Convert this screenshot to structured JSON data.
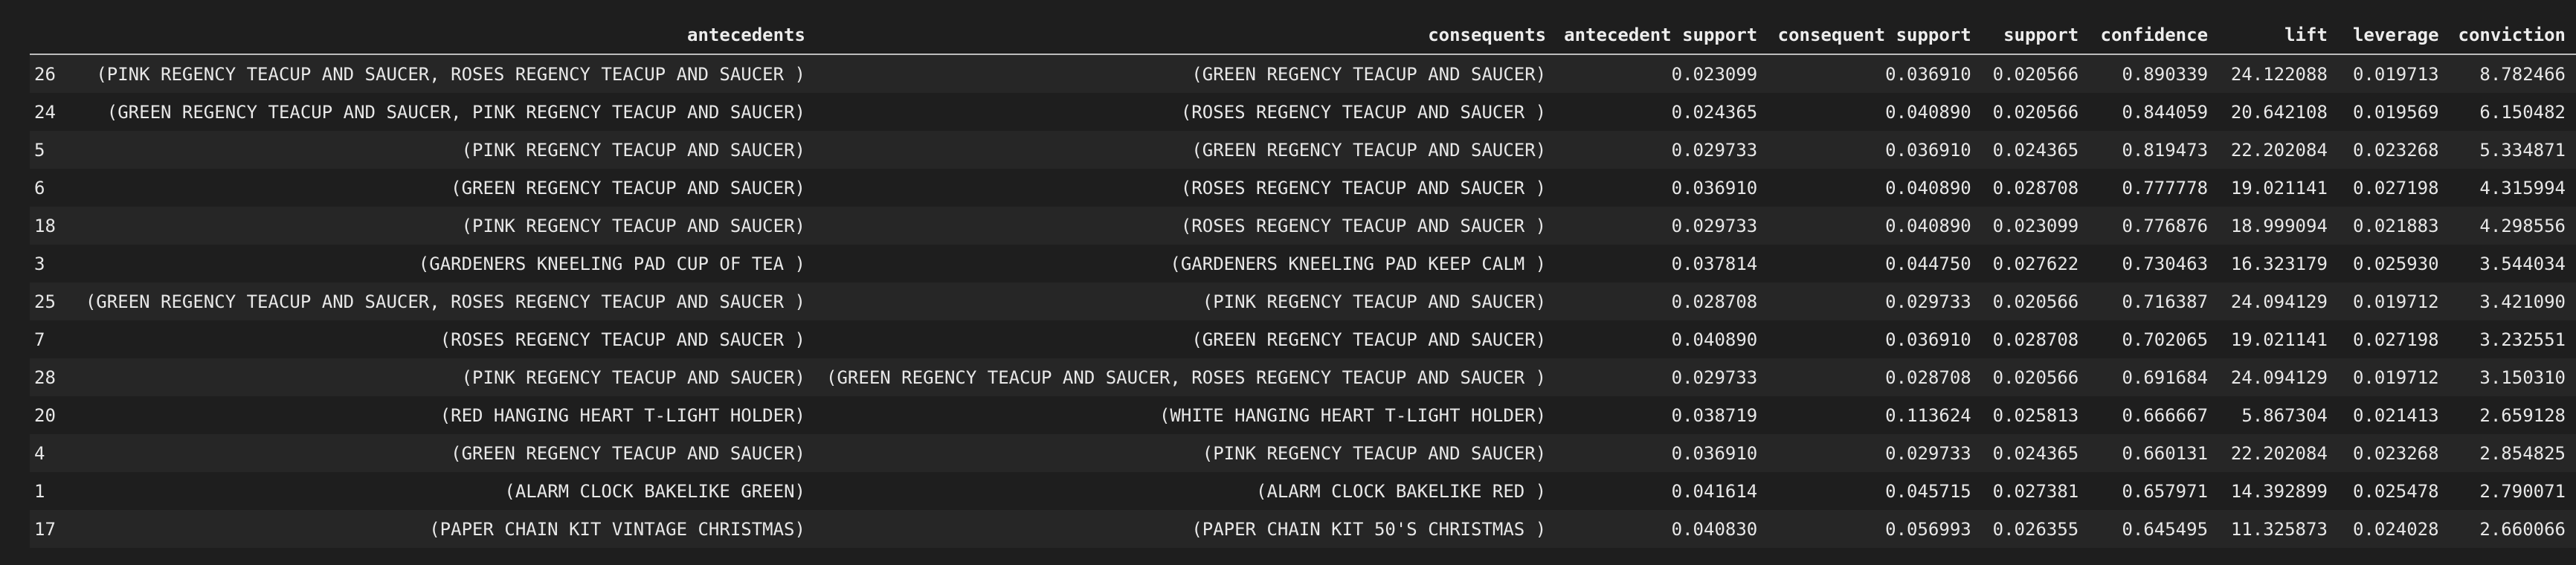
{
  "table": {
    "columns": [
      "",
      "antecedents",
      "consequents",
      "antecedent support",
      "consequent support",
      "support",
      "confidence",
      "lift",
      "leverage",
      "conviction"
    ],
    "rows": [
      [
        "26",
        "(PINK REGENCY TEACUP AND SAUCER, ROSES REGENCY TEACUP AND SAUCER )",
        "(GREEN REGENCY TEACUP AND SAUCER)",
        "0.023099",
        "0.036910",
        "0.020566",
        "0.890339",
        "24.122088",
        "0.019713",
        "8.782466"
      ],
      [
        "24",
        "(GREEN REGENCY TEACUP AND SAUCER, PINK REGENCY TEACUP AND SAUCER)",
        "(ROSES REGENCY TEACUP AND SAUCER )",
        "0.024365",
        "0.040890",
        "0.020566",
        "0.844059",
        "20.642108",
        "0.019569",
        "6.150482"
      ],
      [
        "5",
        "(PINK REGENCY TEACUP AND SAUCER)",
        "(GREEN REGENCY TEACUP AND SAUCER)",
        "0.029733",
        "0.036910",
        "0.024365",
        "0.819473",
        "22.202084",
        "0.023268",
        "5.334871"
      ],
      [
        "6",
        "(GREEN REGENCY TEACUP AND SAUCER)",
        "(ROSES REGENCY TEACUP AND SAUCER )",
        "0.036910",
        "0.040890",
        "0.028708",
        "0.777778",
        "19.021141",
        "0.027198",
        "4.315994"
      ],
      [
        "18",
        "(PINK REGENCY TEACUP AND SAUCER)",
        "(ROSES REGENCY TEACUP AND SAUCER )",
        "0.029733",
        "0.040890",
        "0.023099",
        "0.776876",
        "18.999094",
        "0.021883",
        "4.298556"
      ],
      [
        "3",
        "(GARDENERS KNEELING PAD CUP OF TEA )",
        "(GARDENERS KNEELING PAD KEEP CALM )",
        "0.037814",
        "0.044750",
        "0.027622",
        "0.730463",
        "16.323179",
        "0.025930",
        "3.544034"
      ],
      [
        "25",
        "(GREEN REGENCY TEACUP AND SAUCER, ROSES REGENCY TEACUP AND SAUCER )",
        "(PINK REGENCY TEACUP AND SAUCER)",
        "0.028708",
        "0.029733",
        "0.020566",
        "0.716387",
        "24.094129",
        "0.019712",
        "3.421090"
      ],
      [
        "7",
        "(ROSES REGENCY TEACUP AND SAUCER )",
        "(GREEN REGENCY TEACUP AND SAUCER)",
        "0.040890",
        "0.036910",
        "0.028708",
        "0.702065",
        "19.021141",
        "0.027198",
        "3.232551"
      ],
      [
        "28",
        "(PINK REGENCY TEACUP AND SAUCER)",
        "(GREEN REGENCY TEACUP AND SAUCER, ROSES REGENCY TEACUP AND SAUCER )",
        "0.029733",
        "0.028708",
        "0.020566",
        "0.691684",
        "24.094129",
        "0.019712",
        "3.150310"
      ],
      [
        "20",
        "(RED HANGING HEART T-LIGHT HOLDER)",
        "(WHITE HANGING HEART T-LIGHT HOLDER)",
        "0.038719",
        "0.113624",
        "0.025813",
        "0.666667",
        "5.867304",
        "0.021413",
        "2.659128"
      ],
      [
        "4",
        "(GREEN REGENCY TEACUP AND SAUCER)",
        "(PINK REGENCY TEACUP AND SAUCER)",
        "0.036910",
        "0.029733",
        "0.024365",
        "0.660131",
        "22.202084",
        "0.023268",
        "2.854825"
      ],
      [
        "1",
        "(ALARM CLOCK BAKELIKE GREEN)",
        "(ALARM CLOCK BAKELIKE RED )",
        "0.041614",
        "0.045715",
        "0.027381",
        "0.657971",
        "14.392899",
        "0.025478",
        "2.790071"
      ],
      [
        "17",
        "(PAPER CHAIN KIT VINTAGE CHRISTMAS)",
        "(PAPER CHAIN KIT 50'S CHRISTMAS )",
        "0.040830",
        "0.056993",
        "0.026355",
        "0.645495",
        "11.325873",
        "0.024028",
        "2.660066"
      ]
    ]
  }
}
